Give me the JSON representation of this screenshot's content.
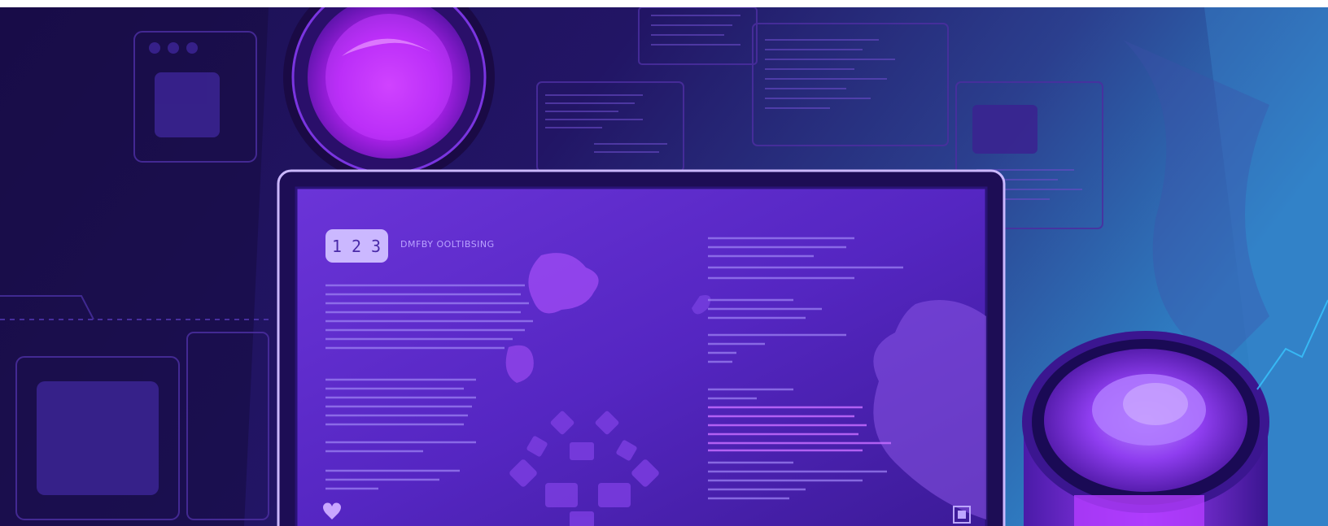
{
  "screen": {
    "badge": "1 2 3",
    "heading": "DMFBY OOLTIBSING"
  },
  "colors": {
    "background_dark": "#1a0f4a",
    "background_teal": "#2a6fb0",
    "screen_fill": "#5a2ac8",
    "lens_magenta": "#c126ff",
    "text_lines": "#9a7cf0"
  },
  "icons": [
    "camera-lens-icon",
    "puzzle-piece-icon",
    "heart-icon",
    "qr-code-icon"
  ]
}
